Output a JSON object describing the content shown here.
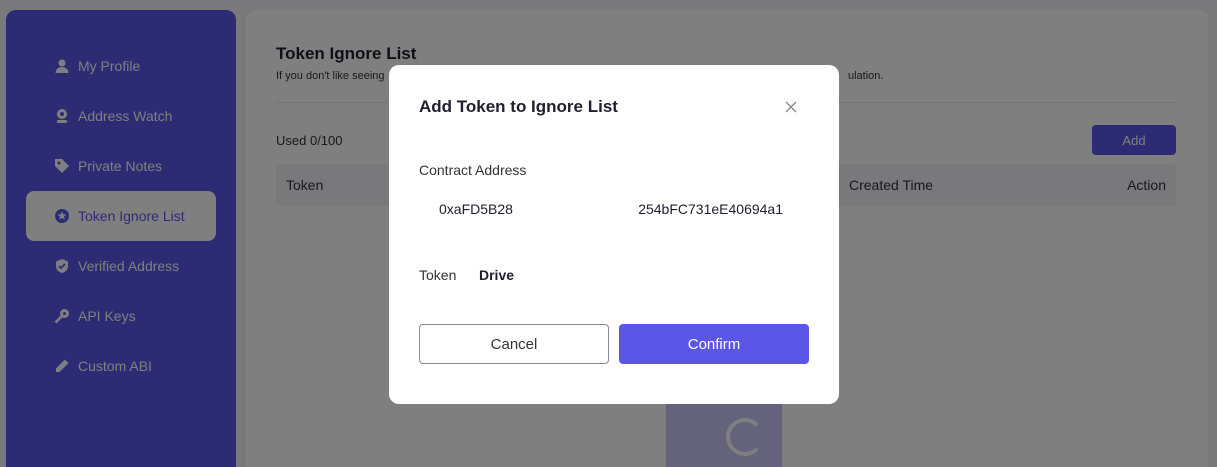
{
  "colors": {
    "brand": "#5b56e8",
    "overlay": "rgba(0,0,0,0.5)"
  },
  "sidebar": {
    "items": [
      {
        "label": "My Profile",
        "icon": "user-icon"
      },
      {
        "label": "Address Watch",
        "icon": "address-watch-icon"
      },
      {
        "label": "Private Notes",
        "icon": "tag-icon"
      },
      {
        "label": "Token Ignore List",
        "icon": "token-ignore-icon",
        "active": true
      },
      {
        "label": "Verified Address",
        "icon": "verified-icon"
      },
      {
        "label": "API Keys",
        "icon": "key-icon"
      },
      {
        "label": "Custom ABI",
        "icon": "edit-icon"
      }
    ]
  },
  "main": {
    "title": "Token Ignore List",
    "description_left": "If you don't like seeing",
    "description_right": "ulation.",
    "used": "Used 0/100",
    "add_label": "Add",
    "table": {
      "columns": [
        "Token",
        "Created Time",
        "Action"
      ]
    }
  },
  "modal": {
    "title": "Add Token to Ignore List",
    "contract_label": "Contract Address",
    "contract_value_start": "0xaFD5B28",
    "contract_value_end": "254bFC731eE40694a1",
    "token_label": "Token",
    "token_value": "Drive",
    "cancel_label": "Cancel",
    "confirm_label": "Confirm"
  }
}
